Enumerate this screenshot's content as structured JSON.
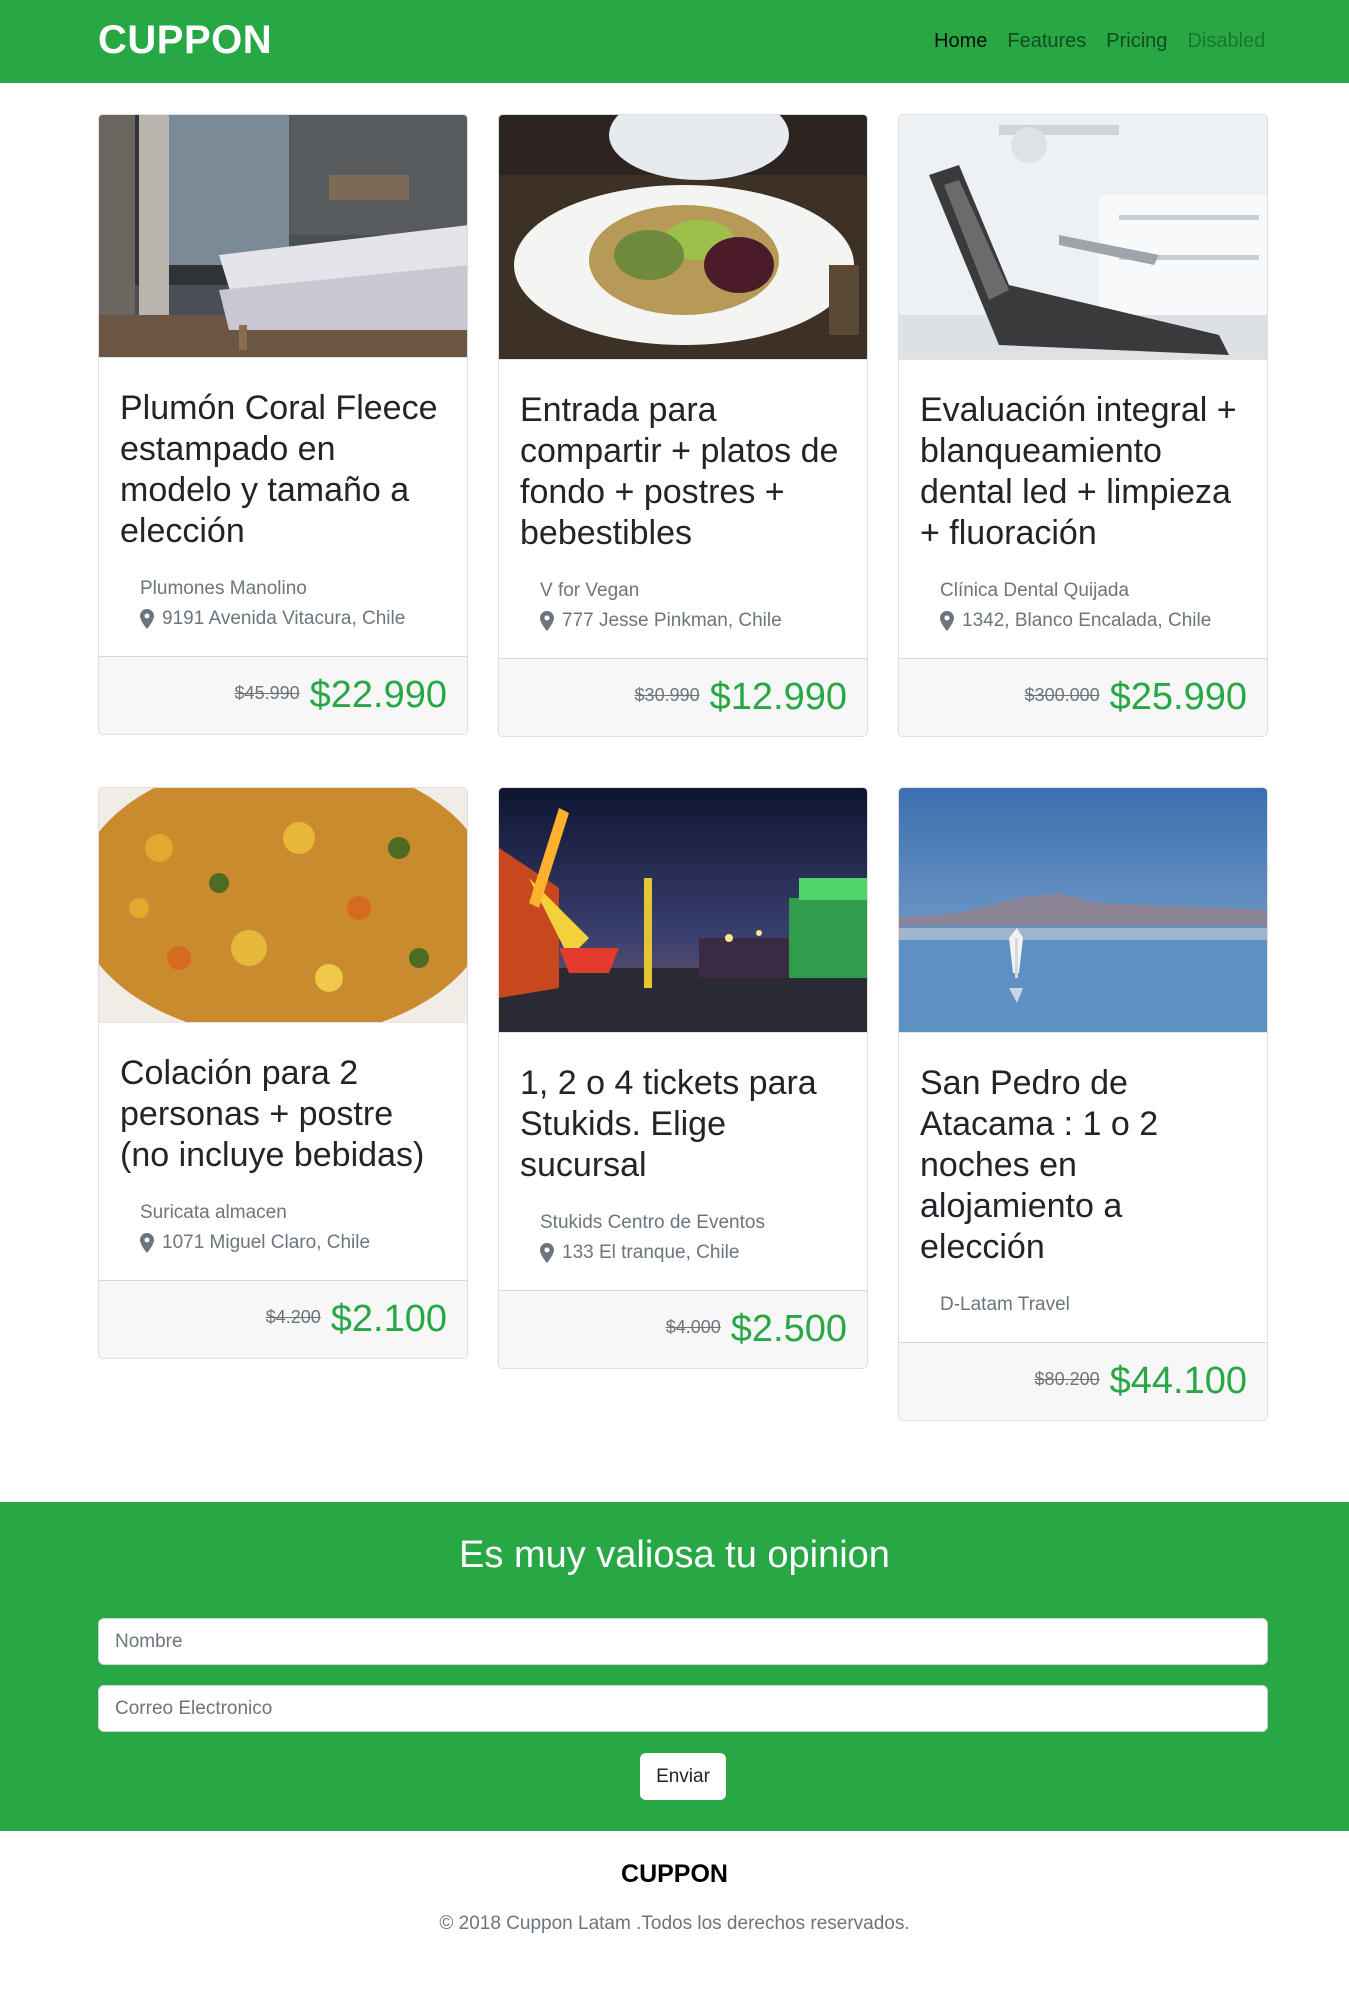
{
  "navbar": {
    "brand": "CUPPON",
    "links": [
      "Home",
      "Features",
      "Pricing",
      "Disabled"
    ]
  },
  "cards": [
    {
      "image": "bedroom-photo",
      "title": "Plumón Coral Fleece estampado en modelo y tamaño a elección",
      "vendor": "Plumones Manolino",
      "location": "9191 Avenida Vitacura, Chile",
      "old_price": "$45.990",
      "price": "$22.990"
    },
    {
      "image": "salad-plate-photo",
      "title": "Entrada para compartir + platos de fondo + postres + bebestibles",
      "vendor": "V for Vegan",
      "location": "777 Jesse Pinkman, Chile",
      "old_price": "$30.990",
      "price": "$12.990"
    },
    {
      "image": "dental-chair-photo",
      "title": "Evaluación integral + blanqueamiento dental led + limpieza + fluoración",
      "vendor": "Clínica Dental Quijada",
      "location": "1342, Blanco Encalada, Chile",
      "old_price": "$300.000",
      "price": "$25.990"
    },
    {
      "image": "food-dish-photo",
      "title": "Colación para 2 personas + postre (no incluye bebidas)",
      "vendor": "Suricata almacen",
      "location": "1071 Miguel Claro, Chile",
      "old_price": "$4.200",
      "price": "$2.100"
    },
    {
      "image": "carnival-night-photo",
      "title": "1, 2 o 4 tickets para Stukids. Elige sucursal",
      "vendor": "Stukids Centro de Eventos",
      "location": "133 El tranque, Chile",
      "old_price": "$4.000",
      "price": "$2.500"
    },
    {
      "image": "salt-flat-flamingo-photo",
      "title": "San Pedro de Atacama : 1 o 2 noches en alojamiento a elección",
      "vendor": "D-Latam Travel",
      "location": "",
      "old_price": "$80.200",
      "price": "$44.100"
    }
  ],
  "feedback": {
    "title": "Es muy valiosa tu opinion",
    "name_placeholder": "Nombre",
    "email_placeholder": "Correo Electronico",
    "submit_label": "Enviar"
  },
  "footer": {
    "brand": "CUPPON",
    "copyright": "© 2018 Cuppon Latam .Todos los derechos reservados."
  },
  "colors": {
    "brand_green": "#28a745",
    "price_green": "#28a745",
    "muted": "#6c757d"
  }
}
